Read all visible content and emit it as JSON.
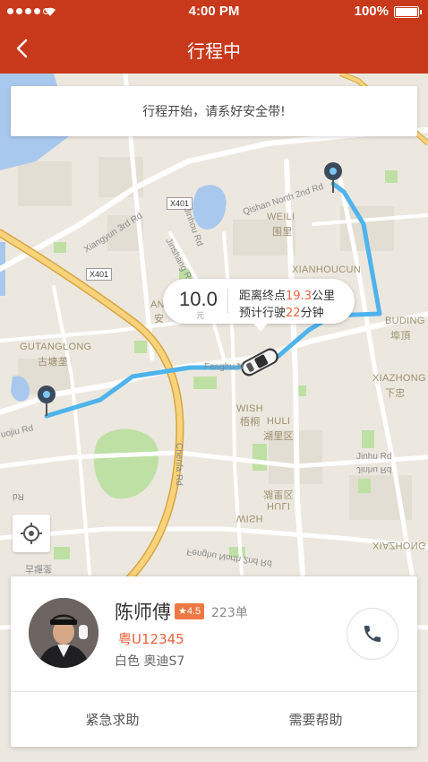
{
  "status_bar": {
    "time": "4:00 PM",
    "battery_text": "100%",
    "battery_level": 1.0,
    "signal_dots_filled": 4,
    "signal_dots_total": 5
  },
  "nav": {
    "title": "行程中",
    "back_icon": "chevron-left-icon"
  },
  "notice": {
    "text": "行程开始，请系好安全带!"
  },
  "trip_info": {
    "fare": "10.0",
    "fare_unit": "元",
    "distance_prefix": "距离终点",
    "distance_value": "19.3",
    "distance_suffix": "公里",
    "eta_prefix": "预计行驶",
    "eta_value": "22",
    "eta_suffix": "分钟"
  },
  "map": {
    "labels": {
      "xiangyun": "Xiangyun 3rd Rd",
      "x401a": "X401",
      "x401b": "X401",
      "jinhou": "Jinhou Rd",
      "qishan": "Qishan North 2nd Rd",
      "weili_en": "WEILI",
      "weili_cn": "围里",
      "jinshang": "Jinshang Rd",
      "xianhoucun": "XIANHOUCUN",
      "an_en": "AN",
      "an_cn": "安",
      "buding_en": "BUDING",
      "buding_cn": "埠頂",
      "gutanglong_en": "GUTANGLONG",
      "gutanglong_cn": "古塘垄",
      "fenghu": "Fenghu N",
      "xiazhong_en": "XIAZHONG",
      "xiazhong_cn": "下忠",
      "wish_en": "WISH",
      "wish_cn": "梧桐",
      "huli_en": "HULI",
      "huli_cn": "湖里区",
      "uojiu": "uojiu Rd",
      "chenfa": "Chenfa Rd",
      "jinhu": "Jinhu Rd",
      "jinhu_flip": "Jinhu Rd",
      "rd_flip": "Rd",
      "huli_flip_cn": "湖里区",
      "huli_flip_en": "HULI",
      "wish_flip_en": "WISH",
      "xiazhong_flip": "XIAZHONG",
      "fenghu_flip": "Fenghu North 2nd Rd",
      "small_flip": "古塘垄"
    },
    "colors": {
      "route": "#4fb3ec",
      "arterial": "#f7d37b",
      "arterial_stroke": "#d9a441",
      "water": "#a9c8ee",
      "park": "#bfe0a4",
      "road": "#ffffff",
      "block": "#e3ded3"
    }
  },
  "driver": {
    "name": "陈师傅",
    "rating": "★4.5",
    "orders": "223单",
    "plate": "粤U12345",
    "car": "白色 奥迪S7"
  },
  "actions": {
    "emergency": "紧急求助",
    "help": "需要帮助"
  },
  "icons": {
    "locate": "crosshair-icon",
    "call": "phone-icon",
    "origin_pin": "map-pin-icon",
    "destination_pin": "map-pin-icon",
    "car": "car-icon"
  }
}
